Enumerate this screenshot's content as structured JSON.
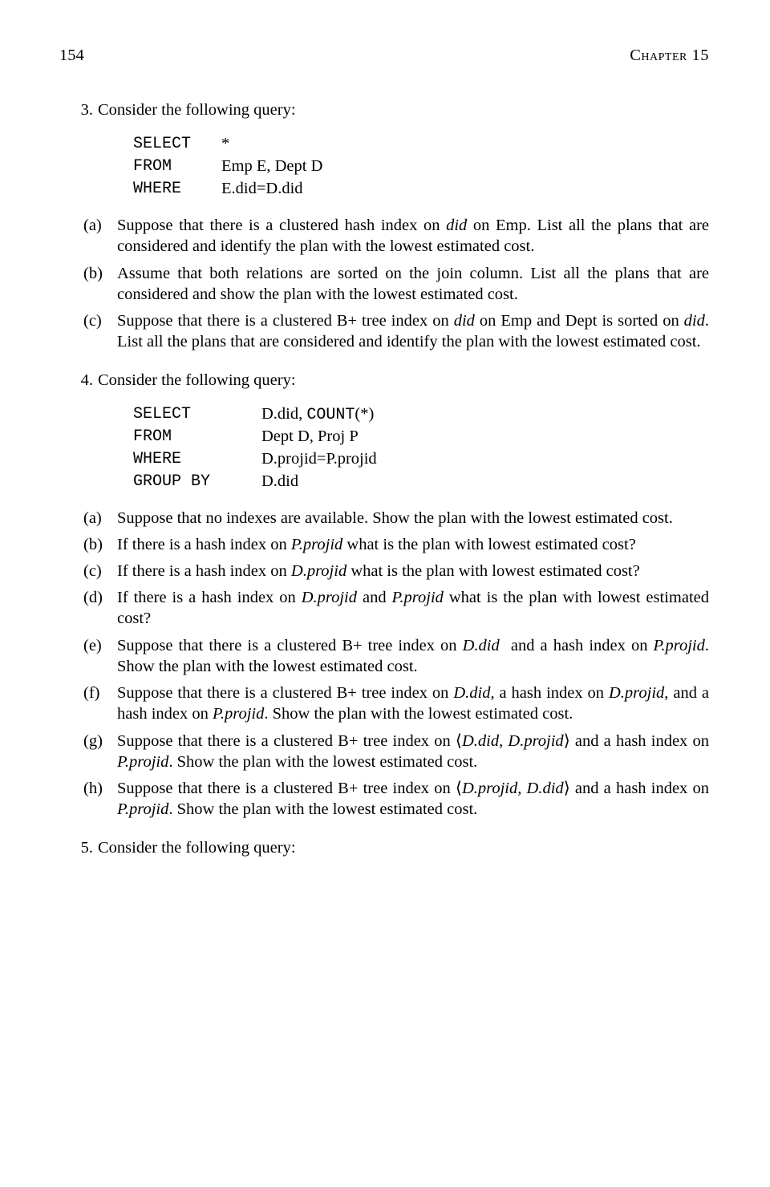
{
  "header": {
    "pageNum": "154",
    "chapter": "Chapter 15"
  },
  "q3": {
    "num": "3.",
    "lead": "Consider the following query:",
    "query": {
      "select": {
        "kw": "SELECT",
        "val": "*"
      },
      "from": {
        "kw": "FROM",
        "val": "Emp E, Dept D"
      },
      "where": {
        "kw": "WHERE",
        "val": "E.did=D.did"
      }
    },
    "a": {
      "label": "(a)",
      "text": "Suppose that there is a clustered hash index on did on Emp. List all the plans that are considered and identify the plan with the lowest estimated cost."
    },
    "b": {
      "label": "(b)",
      "text": "Assume that both relations are sorted on the join column. List all the plans that are considered and show the plan with the lowest estimated cost."
    },
    "c": {
      "label": "(c)",
      "text": "Suppose that there is a clustered B+ tree index on did on Emp and Dept is sorted on did. List all the plans that are considered and identify the plan with the lowest estimated cost."
    }
  },
  "q4": {
    "num": "4.",
    "lead": "Consider the following query:",
    "query": {
      "select": {
        "kw": "SELECT",
        "val1": "D.did, ",
        "count": "COUNT",
        "val2": "(*)"
      },
      "from": {
        "kw": "FROM",
        "val": "Dept D, Proj P"
      },
      "where": {
        "kw": "WHERE",
        "val": "D.projid=P.projid"
      },
      "groupby": {
        "kw": "GROUP BY",
        "val": "D.did"
      }
    },
    "a": {
      "label": "(a)",
      "text": "Suppose that no indexes are available. Show the plan with the lowest estimated cost."
    },
    "b": {
      "label": "(b)",
      "text": "If there is a hash index on P.projid what is the plan with lowest estimated cost?"
    },
    "c": {
      "label": "(c)",
      "text": "If there is a hash index on D.projid what is the plan with lowest estimated cost?"
    },
    "d": {
      "label": "(d)",
      "text": "If there is a hash index on D.projid and P.projid what is the plan with lowest estimated cost?"
    },
    "e": {
      "label": "(e)",
      "text": "Suppose that there is a clustered B+ tree index on D.did  and a hash index on P.projid. Show the plan with the lowest estimated cost."
    },
    "f": {
      "label": "(f)",
      "text": "Suppose that there is a clustered B+ tree index on D.did, a hash index on D.projid, and a hash index on P.projid. Show the plan with the lowest estimated cost."
    },
    "g": {
      "label": "(g)",
      "text": "Suppose that there is a clustered B+ tree index on ⟨D.did, D.projid⟩ and a hash index on P.projid. Show the plan with the lowest estimated cost."
    },
    "h": {
      "label": "(h)",
      "text": "Suppose that there is a clustered B+ tree index on ⟨D.projid, D.did⟩ and a hash index on P.projid. Show the plan with the lowest estimated cost."
    }
  },
  "q5": {
    "num": "5.",
    "lead": "Consider the following query:"
  }
}
